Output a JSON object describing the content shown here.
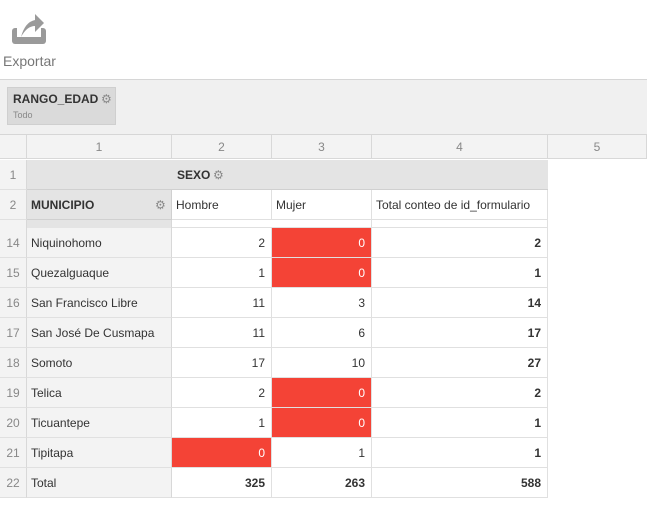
{
  "toolbar": {
    "export_label": "Exportar",
    "export_icon": "upload-icon"
  },
  "filter": {
    "label": "RANGO_EDAD",
    "value": "Todo",
    "icon": "gear-icon"
  },
  "column_numbers": [
    "1",
    "2",
    "3",
    "4",
    "5"
  ],
  "header_rows": {
    "row1_num": "1",
    "row2_num": "2",
    "pivot_column_field": "SEXO",
    "row_field": "MUNICIPIO",
    "columns": [
      "Hombre",
      "Mujer",
      "Total conteo de id_formulario"
    ]
  },
  "rows": [
    {
      "num": "14",
      "municipio": "Niquinohomo",
      "hombre": "2",
      "mujer": "0",
      "total": "2",
      "highlight": "mujer"
    },
    {
      "num": "15",
      "municipio": "Quezalguaque",
      "hombre": "1",
      "mujer": "0",
      "total": "1",
      "highlight": "mujer"
    },
    {
      "num": "16",
      "municipio": "San Francisco Libre",
      "hombre": "11",
      "mujer": "3",
      "total": "14",
      "highlight": ""
    },
    {
      "num": "17",
      "municipio": "San José De Cusmapa",
      "hombre": "11",
      "mujer": "6",
      "total": "17",
      "highlight": ""
    },
    {
      "num": "18",
      "municipio": "Somoto",
      "hombre": "17",
      "mujer": "10",
      "total": "27",
      "highlight": ""
    },
    {
      "num": "19",
      "municipio": "Telica",
      "hombre": "2",
      "mujer": "0",
      "total": "2",
      "highlight": "mujer"
    },
    {
      "num": "20",
      "municipio": "Ticuantepe",
      "hombre": "1",
      "mujer": "0",
      "total": "1",
      "highlight": "mujer"
    },
    {
      "num": "21",
      "municipio": "Tipitapa",
      "hombre": "0",
      "mujer": "1",
      "total": "1",
      "highlight": "hombre"
    }
  ],
  "total_row": {
    "num": "22",
    "label": "Total",
    "hombre": "325",
    "mujer": "263",
    "total": "588"
  },
  "colors": {
    "highlight": "#f44336",
    "header_gray": "#e4e4e4"
  }
}
